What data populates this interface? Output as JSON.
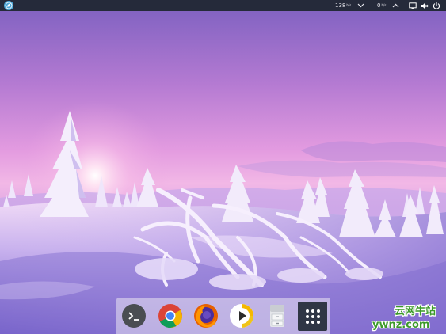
{
  "top_panel": {
    "download_speed": "138",
    "download_unit": "b/s",
    "upload_speed": "0",
    "upload_unit": "b/s",
    "icons": [
      "deepin-launcher-icon",
      "arrow-down-icon",
      "arrow-up-icon",
      "monitor-icon",
      "volume-muted-icon",
      "power-icon"
    ]
  },
  "dock": {
    "items": [
      "terminal-icon",
      "chrome-icon",
      "firefox-icon",
      "media-player-icon",
      "file-manager-icon",
      "app-grid-icon"
    ]
  },
  "watermark": {
    "text": "云网牛站",
    "url": "ywnz.com"
  },
  "colors": {
    "panel": "#252a3a",
    "watermark_green": "#3c9a2a"
  }
}
